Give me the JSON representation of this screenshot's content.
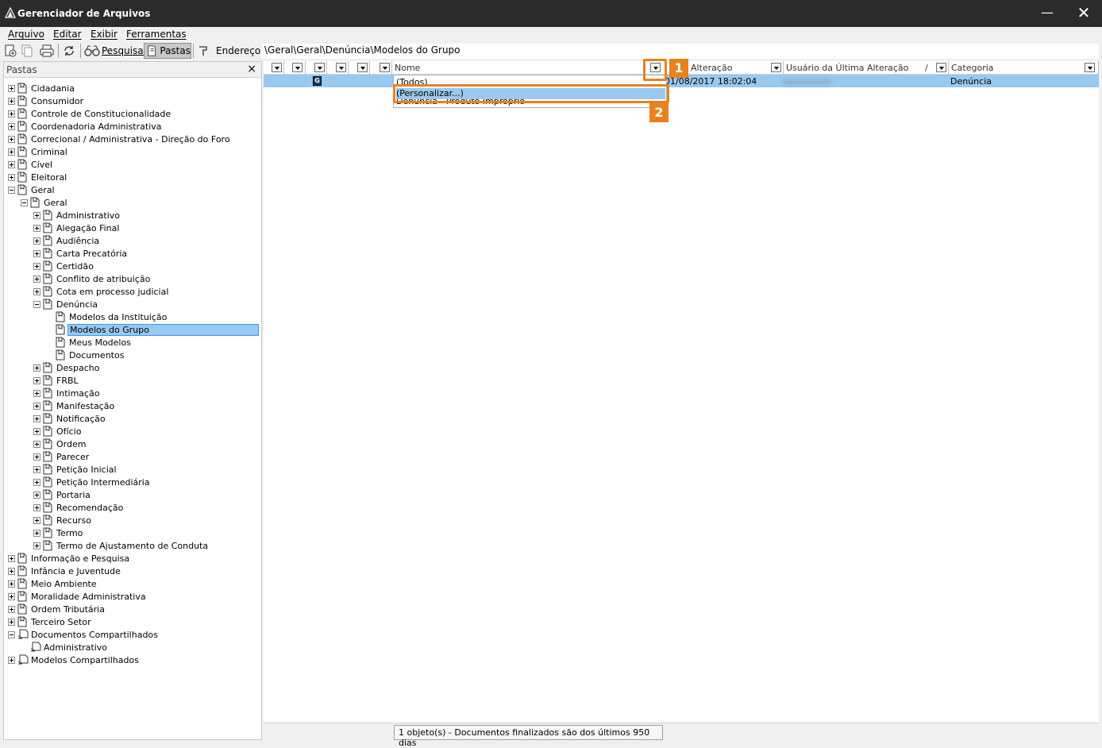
{
  "window": {
    "title": "Gerenciador de Arquivos",
    "minimize_glyph": "—",
    "close_glyph": "✕"
  },
  "menu": [
    "Arquivo",
    "Editar",
    "Exibir",
    "Ferramentas"
  ],
  "toolbar": {
    "search_label": "Pesquisar",
    "folders_label": "Pastas",
    "address_label": "Endereço",
    "address_value": "\\Geral\\Geral\\Denúncia\\Modelos do Grupo"
  },
  "folders_pane": {
    "title": "Pastas",
    "close_glyph": "×"
  },
  "tree": [
    "Cidadania",
    "Consumidor",
    "Controle de Constitucionalidade",
    "Coordenadoria Administrativa",
    "Correcional / Administrativa - Direção do Foro",
    "Criminal",
    "Cível",
    "Eleitoral",
    "Geral",
    "Geral",
    "Administrativo",
    "Alegação Final",
    "Audiência",
    "Carta Precatória",
    "Certidão",
    "Conflito de atribuição",
    "Cota em processo judicial",
    "Denúncia",
    "Modelos da Instituição",
    "Modelos do Grupo",
    "Meus Modelos",
    "Documentos",
    "Despacho",
    "FRBL",
    "Intimação",
    "Manifestação",
    "Notificação",
    "Ofício",
    "Ordem",
    "Parecer",
    "Petição Inicial",
    "Petição Intermediária",
    "Portaria",
    "Recomendação",
    "Recurso",
    "Termo",
    "Termo de Ajustamento de Conduta",
    "Informação e Pesquisa",
    "Infância e Juventude",
    "Meio Ambiente",
    "Moralidade Administrativa",
    "Ordem Tributária",
    "Terceiro Setor",
    "Documentos Compartilhados",
    "Administrativo",
    "Modelos Compartilhados"
  ],
  "grid": {
    "columns": {
      "name": "Nome",
      "changed": "Alteração",
      "last_user": "Usuário da Última Alteração",
      "sort_glyph": "/",
      "category": "Categoria"
    },
    "row": {
      "badge": "G",
      "date": "01/08/2017 18:02:04",
      "category": "Denúncia"
    }
  },
  "filter_dropdown": {
    "options": [
      "(Todos)",
      "(Personalizar...)",
      "Denúncia - Produto Impróprio"
    ]
  },
  "callouts": [
    "1",
    "2"
  ],
  "status": "1 objeto(s) - Documentos finalizados são dos últimos 950 dias",
  "colors": {
    "accent": "#e8821e",
    "selection": "#99c9ef",
    "titlebar": "#2b2b2b"
  }
}
